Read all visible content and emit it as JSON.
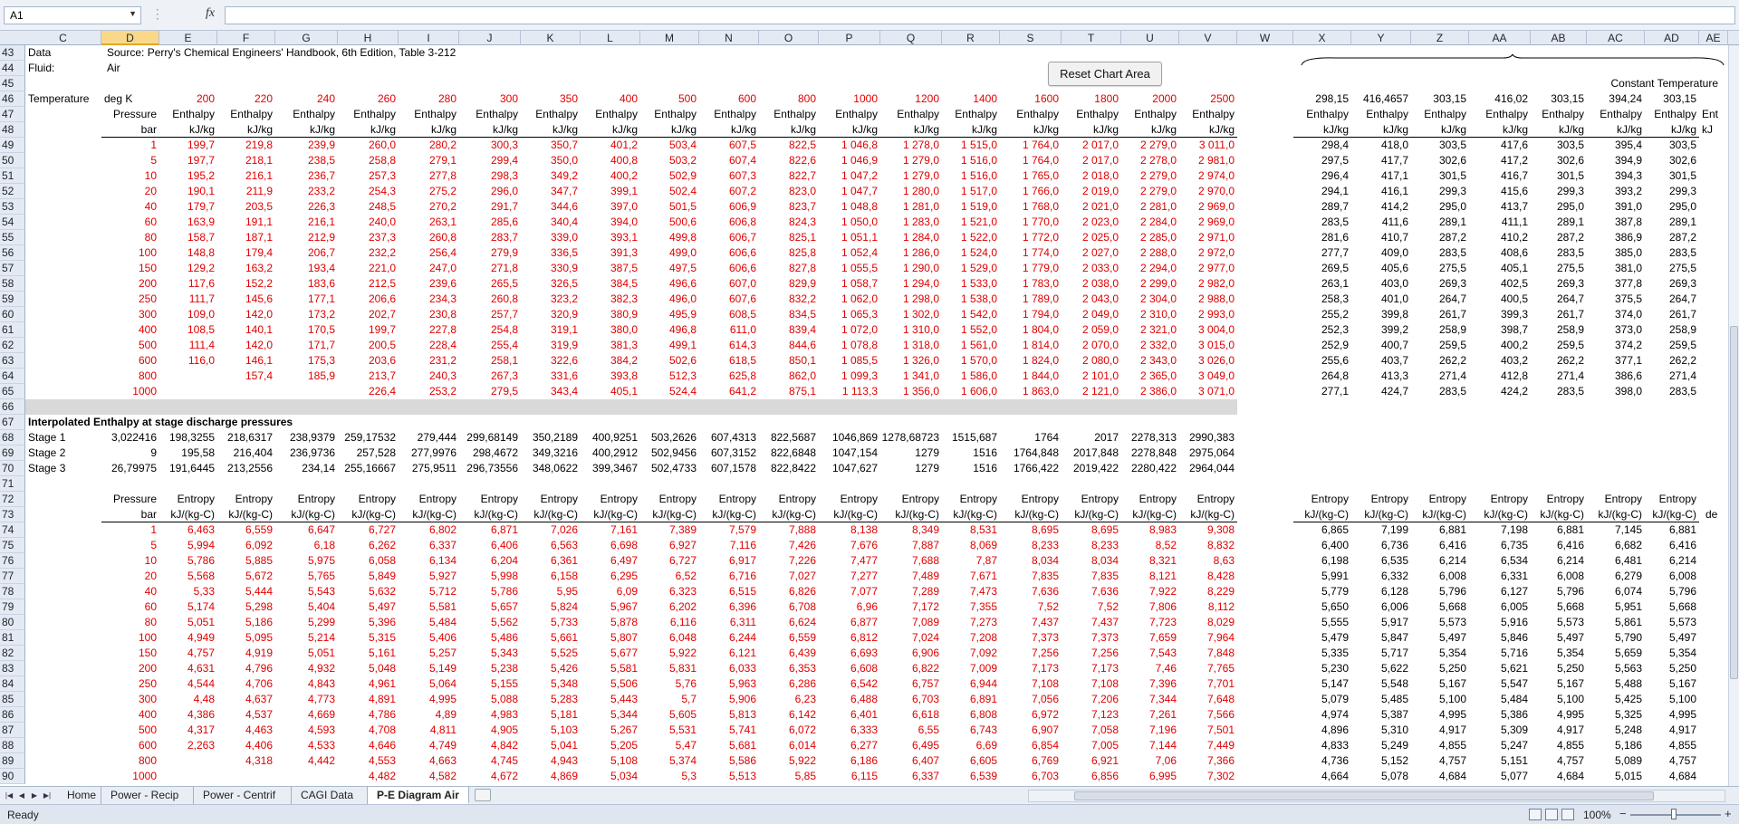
{
  "namebox": "A1",
  "buttons": {
    "reset_chart": "Reset Chart Area"
  },
  "status": "Ready",
  "zoom": "100%",
  "sheets": [
    "Home",
    "Power - Recip",
    "Power - Centrif",
    "CAGI Data",
    "P-E Diagram Air"
  ],
  "active_sheet": "P-E Diagram Air",
  "columns": [
    "C",
    "D",
    "E",
    "F",
    "G",
    "H",
    "I",
    "J",
    "K",
    "L",
    "M",
    "N",
    "O",
    "P",
    "Q",
    "R",
    "S",
    "T",
    "U",
    "V",
    "W",
    "X",
    "Y",
    "Z",
    "AA",
    "AB",
    "AC",
    "AD",
    "AE"
  ],
  "selected_column": "D",
  "info": {
    "data_label": "Data",
    "data_value": "Source: Perry's Chemical Engineers' Handbook, 6th Edition, Table 3-212",
    "fluid_label": "Fluid:",
    "fluid_value": "Air",
    "temperature_label": "Temperature",
    "temperature_unit": "deg K",
    "pressure_label": "Pressure",
    "pressure_unit": "bar",
    "enthalpy_label": "Enthalpy",
    "enthalpy_unit": "kJ/kg",
    "entropy_label": "Entropy",
    "entropy_unit": "kJ/(kg-C)",
    "interp_title": "Interpolated Enthalpy at stage discharge pressures",
    "constant_temperature": "Constant Temperature",
    "stage1": "Stage 1",
    "stage2": "Stage 2",
    "stage3": "Stage 3",
    "cut_ent": "Ent",
    "cut_kj": "kJ",
    "cut_de": "de"
  },
  "temperatures": [
    "200",
    "220",
    "240",
    "260",
    "280",
    "300",
    "350",
    "400",
    "500",
    "600",
    "800",
    "1000",
    "1200",
    "1400",
    "1600",
    "1800",
    "2000",
    "2500"
  ],
  "pressures": [
    "1",
    "5",
    "10",
    "20",
    "40",
    "60",
    "80",
    "100",
    "150",
    "200",
    "250",
    "300",
    "400",
    "500",
    "600",
    "800",
    "1000"
  ],
  "enthalpy": [
    [
      "199,7",
      "219,8",
      "239,9",
      "260,0",
      "280,2",
      "300,3",
      "350,7",
      "401,2",
      "503,4",
      "607,5",
      "822,5",
      "1 046,8",
      "1 278,0",
      "1 515,0",
      "1 764,0",
      "2 017,0",
      "2 279,0",
      "3 011,0"
    ],
    [
      "197,7",
      "218,1",
      "238,5",
      "258,8",
      "279,1",
      "299,4",
      "350,0",
      "400,8",
      "503,2",
      "607,4",
      "822,6",
      "1 046,9",
      "1 279,0",
      "1 516,0",
      "1 764,0",
      "2 017,0",
      "2 278,0",
      "2 981,0"
    ],
    [
      "195,2",
      "216,1",
      "236,7",
      "257,3",
      "277,8",
      "298,3",
      "349,2",
      "400,2",
      "502,9",
      "607,3",
      "822,7",
      "1 047,2",
      "1 279,0",
      "1 516,0",
      "1 765,0",
      "2 018,0",
      "2 279,0",
      "2 974,0"
    ],
    [
      "190,1",
      "211,9",
      "233,2",
      "254,3",
      "275,2",
      "296,0",
      "347,7",
      "399,1",
      "502,4",
      "607,2",
      "823,0",
      "1 047,7",
      "1 280,0",
      "1 517,0",
      "1 766,0",
      "2 019,0",
      "2 279,0",
      "2 970,0"
    ],
    [
      "179,7",
      "203,5",
      "226,3",
      "248,5",
      "270,2",
      "291,7",
      "344,6",
      "397,0",
      "501,5",
      "606,9",
      "823,7",
      "1 048,8",
      "1 281,0",
      "1 519,0",
      "1 768,0",
      "2 021,0",
      "2 281,0",
      "2 969,0"
    ],
    [
      "163,9",
      "191,1",
      "216,1",
      "240,0",
      "263,1",
      "285,6",
      "340,4",
      "394,0",
      "500,6",
      "606,8",
      "824,3",
      "1 050,0",
      "1 283,0",
      "1 521,0",
      "1 770,0",
      "2 023,0",
      "2 284,0",
      "2 969,0"
    ],
    [
      "158,7",
      "187,1",
      "212,9",
      "237,3",
      "260,8",
      "283,7",
      "339,0",
      "393,1",
      "499,8",
      "606,7",
      "825,1",
      "1 051,1",
      "1 284,0",
      "1 522,0",
      "1 772,0",
      "2 025,0",
      "2 285,0",
      "2 971,0"
    ],
    [
      "148,8",
      "179,4",
      "206,7",
      "232,2",
      "256,4",
      "279,9",
      "336,5",
      "391,3",
      "499,0",
      "606,6",
      "825,8",
      "1 052,4",
      "1 286,0",
      "1 524,0",
      "1 774,0",
      "2 027,0",
      "2 288,0",
      "2 972,0"
    ],
    [
      "129,2",
      "163,2",
      "193,4",
      "221,0",
      "247,0",
      "271,8",
      "330,9",
      "387,5",
      "497,5",
      "606,6",
      "827,8",
      "1 055,5",
      "1 290,0",
      "1 529,0",
      "1 779,0",
      "2 033,0",
      "2 294,0",
      "2 977,0"
    ],
    [
      "117,6",
      "152,2",
      "183,6",
      "212,5",
      "239,6",
      "265,5",
      "326,5",
      "384,5",
      "496,6",
      "607,0",
      "829,9",
      "1 058,7",
      "1 294,0",
      "1 533,0",
      "1 783,0",
      "2 038,0",
      "2 299,0",
      "2 982,0"
    ],
    [
      "111,7",
      "145,6",
      "177,1",
      "206,6",
      "234,3",
      "260,8",
      "323,2",
      "382,3",
      "496,0",
      "607,6",
      "832,2",
      "1 062,0",
      "1 298,0",
      "1 538,0",
      "1 789,0",
      "2 043,0",
      "2 304,0",
      "2 988,0"
    ],
    [
      "109,0",
      "142,0",
      "173,2",
      "202,7",
      "230,8",
      "257,7",
      "320,9",
      "380,9",
      "495,9",
      "608,5",
      "834,5",
      "1 065,3",
      "1 302,0",
      "1 542,0",
      "1 794,0",
      "2 049,0",
      "2 310,0",
      "2 993,0"
    ],
    [
      "108,5",
      "140,1",
      "170,5",
      "199,7",
      "227,8",
      "254,8",
      "319,1",
      "380,0",
      "496,8",
      "611,0",
      "839,4",
      "1 072,0",
      "1 310,0",
      "1 552,0",
      "1 804,0",
      "2 059,0",
      "2 321,0",
      "3 004,0"
    ],
    [
      "111,4",
      "142,0",
      "171,7",
      "200,5",
      "228,4",
      "255,4",
      "319,9",
      "381,3",
      "499,1",
      "614,3",
      "844,6",
      "1 078,8",
      "1 318,0",
      "1 561,0",
      "1 814,0",
      "2 070,0",
      "2 332,0",
      "3 015,0"
    ],
    [
      "116,0",
      "146,1",
      "175,3",
      "203,6",
      "231,2",
      "258,1",
      "322,6",
      "384,2",
      "502,6",
      "618,5",
      "850,1",
      "1 085,5",
      "1 326,0",
      "1 570,0",
      "1 824,0",
      "2 080,0",
      "2 343,0",
      "3 026,0"
    ],
    [
      "",
      "157,4",
      "185,9",
      "213,7",
      "240,3",
      "267,3",
      "331,6",
      "393,8",
      "512,3",
      "625,8",
      "862,0",
      "1 099,3",
      "1 341,0",
      "1 586,0",
      "1 844,0",
      "2 101,0",
      "2 365,0",
      "3 049,0"
    ],
    [
      "",
      "",
      "",
      "226,4",
      "253,2",
      "279,5",
      "343,4",
      "405,1",
      "524,4",
      "641,2",
      "875,1",
      "1 113,3",
      "1 356,0",
      "1 606,0",
      "1 863,0",
      "2 121,0",
      "2 386,0",
      "3 071,0"
    ]
  ],
  "right_temps": [
    "298,15",
    "416,4657",
    "303,15",
    "416,02",
    "303,15",
    "394,24",
    "303,15"
  ],
  "right_enthalpy": [
    [
      "298,4",
      "418,0",
      "303,5",
      "417,6",
      "303,5",
      "395,4",
      "303,5"
    ],
    [
      "297,5",
      "417,7",
      "302,6",
      "417,2",
      "302,6",
      "394,9",
      "302,6"
    ],
    [
      "296,4",
      "417,1",
      "301,5",
      "416,7",
      "301,5",
      "394,3",
      "301,5"
    ],
    [
      "294,1",
      "416,1",
      "299,3",
      "415,6",
      "299,3",
      "393,2",
      "299,3"
    ],
    [
      "289,7",
      "414,2",
      "295,0",
      "413,7",
      "295,0",
      "391,0",
      "295,0"
    ],
    [
      "283,5",
      "411,6",
      "289,1",
      "411,1",
      "289,1",
      "387,8",
      "289,1"
    ],
    [
      "281,6",
      "410,7",
      "287,2",
      "410,2",
      "287,2",
      "386,9",
      "287,2"
    ],
    [
      "277,7",
      "409,0",
      "283,5",
      "408,6",
      "283,5",
      "385,0",
      "283,5"
    ],
    [
      "269,5",
      "405,6",
      "275,5",
      "405,1",
      "275,5",
      "381,0",
      "275,5"
    ],
    [
      "263,1",
      "403,0",
      "269,3",
      "402,5",
      "269,3",
      "377,8",
      "269,3"
    ],
    [
      "258,3",
      "401,0",
      "264,7",
      "400,5",
      "264,7",
      "375,5",
      "264,7"
    ],
    [
      "255,2",
      "399,8",
      "261,7",
      "399,3",
      "261,7",
      "374,0",
      "261,7"
    ],
    [
      "252,3",
      "399,2",
      "258,9",
      "398,7",
      "258,9",
      "373,0",
      "258,9"
    ],
    [
      "252,9",
      "400,7",
      "259,5",
      "400,2",
      "259,5",
      "374,2",
      "259,5"
    ],
    [
      "255,6",
      "403,7",
      "262,2",
      "403,2",
      "262,2",
      "377,1",
      "262,2"
    ],
    [
      "264,8",
      "413,3",
      "271,4",
      "412,8",
      "271,4",
      "386,6",
      "271,4"
    ],
    [
      "277,1",
      "424,7",
      "283,5",
      "424,2",
      "283,5",
      "398,0",
      "283,5"
    ]
  ],
  "stages": [
    [
      "3,022416",
      "198,3255",
      "218,6317",
      "238,9379",
      "259,17532",
      "279,444",
      "299,68149",
      "350,2189",
      "400,9251",
      "503,2626",
      "607,4313",
      "822,5687",
      "1046,869",
      "1278,68723",
      "1515,687",
      "1764",
      "2017",
      "2278,313",
      "2990,383"
    ],
    [
      "9",
      "195,58",
      "216,404",
      "236,9736",
      "257,528",
      "277,9976",
      "298,4672",
      "349,3216",
      "400,2912",
      "502,9456",
      "607,3152",
      "822,6848",
      "1047,154",
      "1279",
      "1516",
      "1764,848",
      "2017,848",
      "2278,848",
      "2975,064"
    ],
    [
      "26,79975",
      "191,6445",
      "213,2556",
      "234,14",
      "255,16667",
      "275,9511",
      "296,73556",
      "348,0622",
      "399,3467",
      "502,4733",
      "607,1578",
      "822,8422",
      "1047,627",
      "1279",
      "1516",
      "1766,422",
      "2019,422",
      "2280,422",
      "2964,044"
    ]
  ],
  "entropy": [
    [
      "6,463",
      "6,559",
      "6,647",
      "6,727",
      "6,802",
      "6,871",
      "7,026",
      "7,161",
      "7,389",
      "7,579",
      "7,888",
      "8,138",
      "8,349",
      "8,531",
      "8,695",
      "8,695",
      "8,983",
      "9,308"
    ],
    [
      "5,994",
      "6,092",
      "6,18",
      "6,262",
      "6,337",
      "6,406",
      "6,563",
      "6,698",
      "6,927",
      "7,116",
      "7,426",
      "7,676",
      "7,887",
      "8,069",
      "8,233",
      "8,233",
      "8,52",
      "8,832"
    ],
    [
      "5,786",
      "5,885",
      "5,975",
      "6,058",
      "6,134",
      "6,204",
      "6,361",
      "6,497",
      "6,727",
      "6,917",
      "7,226",
      "7,477",
      "7,688",
      "7,87",
      "8,034",
      "8,034",
      "8,321",
      "8,63"
    ],
    [
      "5,568",
      "5,672",
      "5,765",
      "5,849",
      "5,927",
      "5,998",
      "6,158",
      "6,295",
      "6,52",
      "6,716",
      "7,027",
      "7,277",
      "7,489",
      "7,671",
      "7,835",
      "7,835",
      "8,121",
      "8,428"
    ],
    [
      "5,33",
      "5,444",
      "5,543",
      "5,632",
      "5,712",
      "5,786",
      "5,95",
      "6,09",
      "6,323",
      "6,515",
      "6,826",
      "7,077",
      "7,289",
      "7,473",
      "7,636",
      "7,636",
      "7,922",
      "8,229"
    ],
    [
      "5,174",
      "5,298",
      "5,404",
      "5,497",
      "5,581",
      "5,657",
      "5,824",
      "5,967",
      "6,202",
      "6,396",
      "6,708",
      "6,96",
      "7,172",
      "7,355",
      "7,52",
      "7,52",
      "7,806",
      "8,112"
    ],
    [
      "5,051",
      "5,186",
      "5,299",
      "5,396",
      "5,484",
      "5,562",
      "5,733",
      "5,878",
      "6,116",
      "6,311",
      "6,624",
      "6,877",
      "7,089",
      "7,273",
      "7,437",
      "7,437",
      "7,723",
      "8,029"
    ],
    [
      "4,949",
      "5,095",
      "5,214",
      "5,315",
      "5,406",
      "5,486",
      "5,661",
      "5,807",
      "6,048",
      "6,244",
      "6,559",
      "6,812",
      "7,024",
      "7,208",
      "7,373",
      "7,373",
      "7,659",
      "7,964"
    ],
    [
      "4,757",
      "4,919",
      "5,051",
      "5,161",
      "5,257",
      "5,343",
      "5,525",
      "5,677",
      "5,922",
      "6,121",
      "6,439",
      "6,693",
      "6,906",
      "7,092",
      "7,256",
      "7,256",
      "7,543",
      "7,848"
    ],
    [
      "4,631",
      "4,796",
      "4,932",
      "5,048",
      "5,149",
      "5,238",
      "5,426",
      "5,581",
      "5,831",
      "6,033",
      "6,353",
      "6,608",
      "6,822",
      "7,009",
      "7,173",
      "7,173",
      "7,46",
      "7,765"
    ],
    [
      "4,544",
      "4,706",
      "4,843",
      "4,961",
      "5,064",
      "5,155",
      "5,348",
      "5,506",
      "5,76",
      "5,963",
      "6,286",
      "6,542",
      "6,757",
      "6,944",
      "7,108",
      "7,108",
      "7,396",
      "7,701"
    ],
    [
      "4,48",
      "4,637",
      "4,773",
      "4,891",
      "4,995",
      "5,088",
      "5,283",
      "5,443",
      "5,7",
      "5,906",
      "6,23",
      "6,488",
      "6,703",
      "6,891",
      "7,056",
      "7,206",
      "7,344",
      "7,648"
    ],
    [
      "4,386",
      "4,537",
      "4,669",
      "4,786",
      "4,89",
      "4,983",
      "5,181",
      "5,344",
      "5,605",
      "5,813",
      "6,142",
      "6,401",
      "6,618",
      "6,808",
      "6,972",
      "7,123",
      "7,261",
      "7,566"
    ],
    [
      "4,317",
      "4,463",
      "4,593",
      "4,708",
      "4,811",
      "4,905",
      "5,103",
      "5,267",
      "5,531",
      "5,741",
      "6,072",
      "6,333",
      "6,55",
      "6,743",
      "6,907",
      "7,058",
      "7,196",
      "7,501"
    ],
    [
      "2,263",
      "4,406",
      "4,533",
      "4,646",
      "4,749",
      "4,842",
      "5,041",
      "5,205",
      "5,47",
      "5,681",
      "6,014",
      "6,277",
      "6,495",
      "6,69",
      "6,854",
      "7,005",
      "7,144",
      "7,449"
    ],
    [
      "",
      "4,318",
      "4,442",
      "4,553",
      "4,663",
      "4,745",
      "4,943",
      "5,108",
      "5,374",
      "5,586",
      "5,922",
      "6,186",
      "6,407",
      "6,605",
      "6,769",
      "6,921",
      "7,06",
      "7,366"
    ],
    [
      "",
      "",
      "",
      "4,482",
      "4,582",
      "4,672",
      "4,869",
      "5,034",
      "5,3",
      "5,513",
      "5,85",
      "6,115",
      "6,337",
      "6,539",
      "6,703",
      "6,856",
      "6,995",
      "7,302"
    ]
  ],
  "right_entropy": [
    [
      "6,865",
      "7,199",
      "6,881",
      "7,198",
      "6,881",
      "7,145",
      "6,881"
    ],
    [
      "6,400",
      "6,736",
      "6,416",
      "6,735",
      "6,416",
      "6,682",
      "6,416"
    ],
    [
      "6,198",
      "6,535",
      "6,214",
      "6,534",
      "6,214",
      "6,481",
      "6,214"
    ],
    [
      "5,991",
      "6,332",
      "6,008",
      "6,331",
      "6,008",
      "6,279",
      "6,008"
    ],
    [
      "5,779",
      "6,128",
      "5,796",
      "6,127",
      "5,796",
      "6,074",
      "5,796"
    ],
    [
      "5,650",
      "6,006",
      "5,668",
      "6,005",
      "5,668",
      "5,951",
      "5,668"
    ],
    [
      "5,555",
      "5,917",
      "5,573",
      "5,916",
      "5,573",
      "5,861",
      "5,573"
    ],
    [
      "5,479",
      "5,847",
      "5,497",
      "5,846",
      "5,497",
      "5,790",
      "5,497"
    ],
    [
      "5,335",
      "5,717",
      "5,354",
      "5,716",
      "5,354",
      "5,659",
      "5,354"
    ],
    [
      "5,230",
      "5,622",
      "5,250",
      "5,621",
      "5,250",
      "5,563",
      "5,250"
    ],
    [
      "5,147",
      "5,548",
      "5,167",
      "5,547",
      "5,167",
      "5,488",
      "5,167"
    ],
    [
      "5,079",
      "5,485",
      "5,100",
      "5,484",
      "5,100",
      "5,425",
      "5,100"
    ],
    [
      "4,974",
      "5,387",
      "4,995",
      "5,386",
      "4,995",
      "5,325",
      "4,995"
    ],
    [
      "4,896",
      "5,310",
      "4,917",
      "5,309",
      "4,917",
      "5,248",
      "4,917"
    ],
    [
      "4,833",
      "5,249",
      "4,855",
      "5,247",
      "4,855",
      "5,186",
      "4,855"
    ],
    [
      "4,736",
      "5,152",
      "4,757",
      "5,151",
      "4,757",
      "5,089",
      "4,757"
    ],
    [
      "4,664",
      "5,078",
      "4,684",
      "5,077",
      "4,684",
      "5,015",
      "4,684"
    ]
  ],
  "row_numbers": [
    "43",
    "44",
    "45",
    "46",
    "47",
    "48",
    "49",
    "50",
    "51",
    "52",
    "53",
    "54",
    "55",
    "56",
    "57",
    "58",
    "59",
    "60",
    "61",
    "62",
    "63",
    "64",
    "65",
    "66",
    "67",
    "68",
    "69",
    "70",
    "71",
    "72",
    "73",
    "74",
    "75",
    "76",
    "77",
    "78",
    "79",
    "80",
    "81",
    "82",
    "83",
    "84",
    "85",
    "86",
    "87",
    "88",
    "89",
    "90"
  ],
  "colors": {
    "red": "#e00000",
    "header_bg": "#e4eaf3",
    "selected_header": "#f9d989",
    "separator": "#d9d9d9"
  }
}
